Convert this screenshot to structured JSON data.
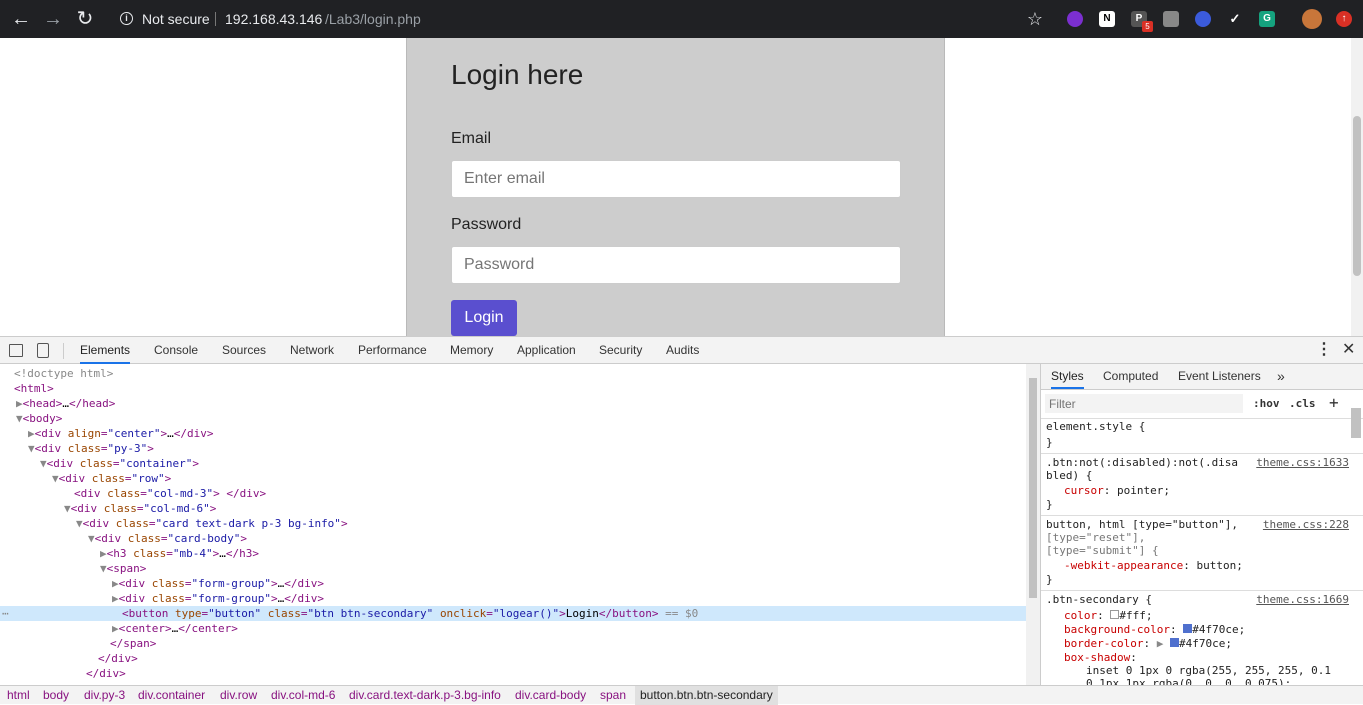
{
  "browser": {
    "security_label": "Not secure",
    "url_host": "192.168.43.146",
    "url_path": "/Lab3/login.php",
    "ext_badge": "5"
  },
  "page": {
    "heading": "Login here",
    "email_label": "Email",
    "email_placeholder": "Enter email",
    "password_label": "Password",
    "password_placeholder": "Password",
    "login_button": "Login"
  },
  "devtools": {
    "tabs": [
      "Elements",
      "Console",
      "Sources",
      "Network",
      "Performance",
      "Memory",
      "Application",
      "Security",
      "Audits"
    ],
    "styles_tabs": [
      "Styles",
      "Computed",
      "Event Listeners"
    ],
    "filter_placeholder": "Filter",
    "hov": ":hov",
    "cls": ".cls",
    "breadcrumbs": [
      "html",
      "body",
      "div.py-3",
      "div.container",
      "div.row",
      "div.col-md-6",
      "div.card.text-dark.p-3.bg-info",
      "div.card-body",
      "span",
      "button.btn.btn-secondary"
    ],
    "style_rules": {
      "r0": "element.style {",
      "close": "}",
      "r1a": ".btn:not(:disabled):not(.disa",
      "r1b": "bled) {",
      "r1src": "theme.css:1633",
      "r1p": "cursor",
      "r1v": "pointer;",
      "r2a": "button, html [type=\"button\"],",
      "r2b": "[type=\"reset\"],",
      "r2c": "[type=\"submit\"] {",
      "r2src": "theme.css:228",
      "r2p": "-webkit-appearance",
      "r2v": "button;",
      "r3a": ".btn-secondary {",
      "r3src": "theme.css:1669",
      "p1": "color",
      "v1": "#fff;",
      "p2": "background-color",
      "v2": "#4f70ce;",
      "p3": "border-color",
      "v3": "#4f70ce;",
      "p4": "box-shadow",
      "v4": "inset 0 1px 0 rgba(255, 255, 255, 0.1",
      "v5": "0 1px 1px rgba(0, 0, 0, 0.075);"
    }
  },
  "colors": {
    "accent": "#5a4fcf",
    "devtools_bg": "#f3f3f3",
    "selected_row": "#cfe8fc"
  }
}
